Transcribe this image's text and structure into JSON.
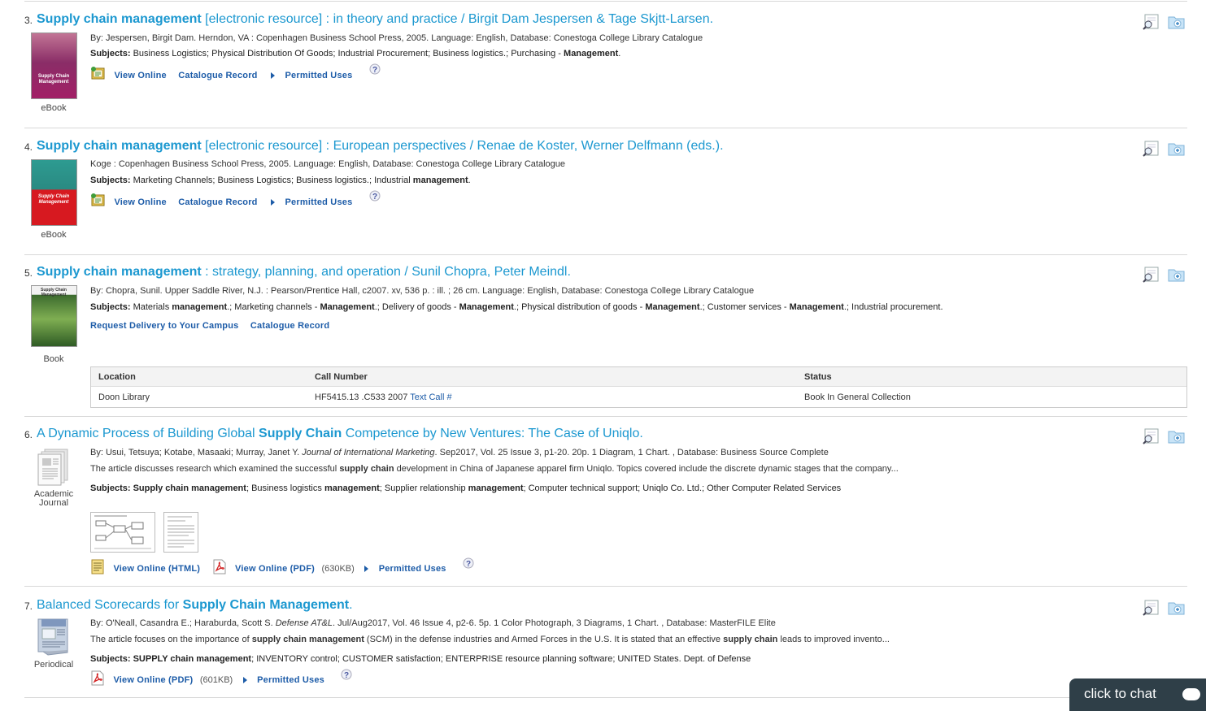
{
  "results": [
    {
      "number": "3.",
      "title_bold": "Supply chain management",
      "title_rest": " [electronic resource] : in theory and practice / Birgit Dam Jespersen & Tage Skjtt-Larsen.",
      "type": "eBook",
      "cover_text": "Supply Chain Management",
      "meta": "By: Jespersen, Birgit Dam. Herndon, VA : Copenhagen Business School Press, 2005. Language: English, Database: Conestoga College Library Catalogue",
      "subjects_label": "Subjects:",
      "subjects_a": " Business Logistics; Physical Distribution Of Goods; Industrial Procurement; Business logistics.; Purchasing - ",
      "subjects_b": "Management",
      "subjects_c": ".",
      "links": [
        "View Online",
        "Catalogue Record",
        "Permitted Uses"
      ]
    },
    {
      "number": "4.",
      "title_bold": "Supply chain management",
      "title_rest": " [electronic resource] : European perspectives / Renae de Koster, Werner Delfmann (eds.).",
      "type": "eBook",
      "cover_text": "Supply Chain Management",
      "meta": "Koge : Copenhagen Business School Press, 2005. Language: English, Database: Conestoga College Library Catalogue",
      "subjects_label": "Subjects:",
      "subjects_a": " Marketing Channels; Business Logistics; Business logistics.; Industrial ",
      "subjects_b": "management",
      "subjects_c": ".",
      "links": [
        "View Online",
        "Catalogue Record",
        "Permitted Uses"
      ]
    },
    {
      "number": "5.",
      "title_bold": "Supply chain management",
      "title_rest": " : strategy, planning, and operation / Sunil Chopra, Peter Meindl.",
      "type": "Book",
      "cover_text": "Supply Chain Management",
      "meta": "By: Chopra, Sunil. Upper Saddle River, N.J. : Pearson/Prentice Hall, c2007. xv, 536 p. : ill. ; 26 cm. Language: English, Database: Conestoga College Library Catalogue",
      "subjects_label": "Subjects:",
      "subjects_parts": [
        " Materials ",
        "management",
        ".; Marketing channels - ",
        "Management",
        ".; Delivery of goods - ",
        "Management",
        ".; Physical distribution of goods - ",
        "Management",
        ".; Customer services - ",
        "Management",
        ".; Industrial procurement."
      ],
      "links": [
        "Request Delivery to Your Campus",
        "Catalogue Record"
      ],
      "holdings": {
        "headers": [
          "Location",
          "Call Number",
          "Status"
        ],
        "row": {
          "location": "Doon Library",
          "call_number": "HF5415.13 .C533 2007",
          "text_call": "Text Call #",
          "status": "Book In General Collection"
        }
      }
    },
    {
      "number": "6.",
      "title_pre": "A Dynamic Process of Building Global ",
      "title_bold": "Supply Chain",
      "title_rest": " Competence by New Ventures: The Case of Uniqlo.",
      "type_line1": "Academic",
      "type_line2": "Journal",
      "meta_pre": "By: Usui, Tetsuya; Kotabe, Masaaki; Murray, Janet Y. ",
      "meta_journal": "Journal of International Marketing",
      "meta_post": ". Sep2017, Vol. 25 Issue 3, p1-20. 20p. 1 Diagram, 1 Chart. , Database: Business Source Complete",
      "abstract_a": "The article discusses research which examined the successful ",
      "abstract_b": "supply chain",
      "abstract_c": " development in China of Japanese apparel firm Uniqlo. Topics covered include the discrete dynamic stages that the company...",
      "subjects_label": "Subjects:",
      "subjects_parts": [
        " ",
        "Supply chain management",
        "; Business logistics ",
        "management",
        "; Supplier relationship ",
        "management",
        "; Computer technical support; Uniqlo Co. Ltd.; Other Computer Related Services"
      ],
      "links": [
        "View Online (HTML)",
        "View Online (PDF)",
        "Permitted Uses"
      ],
      "pdf_size": "(630KB)"
    },
    {
      "number": "7.",
      "title_pre": "Balanced Scorecards for ",
      "title_bold": "Supply Chain Management",
      "title_rest": ".",
      "type": "Periodical",
      "meta_pre": "By: O'Neall, Casandra E.; Haraburda, Scott S. ",
      "meta_journal": "Defense AT&L",
      "meta_post": ". Jul/Aug2017, Vol. 46 Issue 4, p2-6. 5p. 1 Color Photograph, 3 Diagrams, 1 Chart. , Database: MasterFILE Elite",
      "abstract_a": "The article focuses on the importance of ",
      "abstract_b": "supply chain management",
      "abstract_c": " (SCM) in the defense industries and Armed Forces in the U.S. It is stated that an effective ",
      "abstract_d": "supply chain",
      "abstract_e": " leads to improved invento...",
      "subjects_label": "Subjects:",
      "subjects_parts": [
        " ",
        "SUPPLY chain management",
        "; INVENTORY control; CUSTOMER satisfaction; ENTERPRISE resource planning software; UNITED States. Dept. of Defense"
      ],
      "links": [
        "View Online (PDF)",
        "Permitted Uses"
      ],
      "pdf_size": "(601KB)"
    }
  ],
  "chat": {
    "label": "click to chat"
  },
  "colors": {
    "title": "#1c98d0",
    "link": "#1d5ca8",
    "chat_bg": "#2f3f48"
  }
}
